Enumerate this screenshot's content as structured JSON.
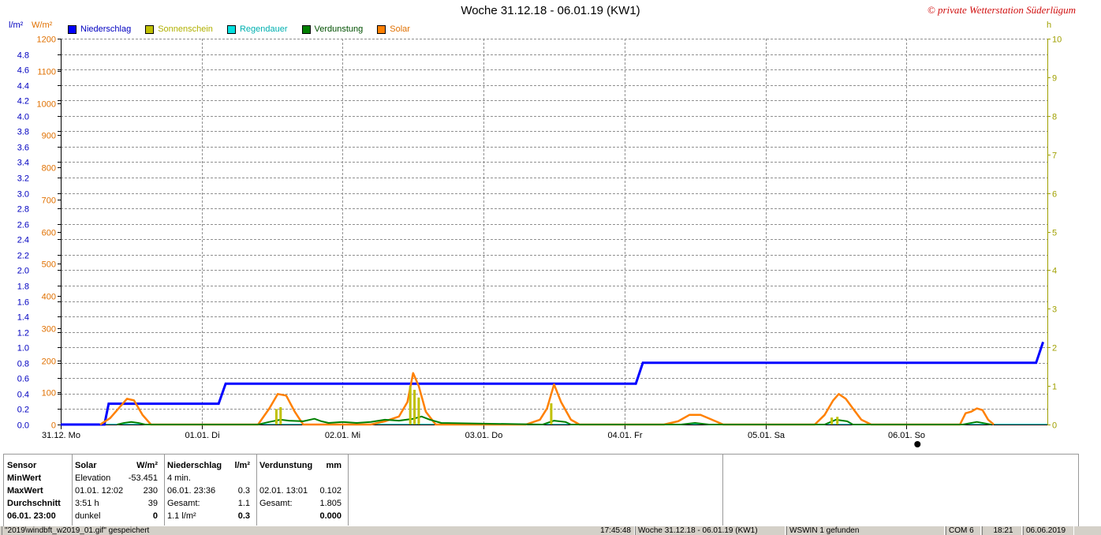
{
  "title": "Woche 31.12.18 - 06.01.19 (KW1)",
  "copyright": "© private Wetterstation Süderlügum",
  "units": {
    "left1": "l/m²",
    "left2": "W/m²",
    "right": "h"
  },
  "legend": [
    {
      "label": "Niederschlag",
      "color": "#0000ff",
      "text_color": "#0000c0"
    },
    {
      "label": "Sonnenschein",
      "color": "#c0c000",
      "text_color": "#b0b000"
    },
    {
      "label": "Regendauer",
      "color": "#00e0e0",
      "text_color": "#00b0b0"
    },
    {
      "label": "Verdunstung",
      "color": "#008000",
      "text_color": "#005000"
    },
    {
      "label": "Solar",
      "color": "#ff8000",
      "text_color": "#e07000"
    }
  ],
  "chart_data": {
    "type": "line",
    "title": "Woche 31.12.18 - 06.01.19 (KW1)",
    "x_range_days": [
      0,
      7
    ],
    "x_ticks": [
      "31.12.  Mo",
      "01.01.  Di",
      "02.01.  Mi",
      "03.01.  Do",
      "04.01.  Fr",
      "05.01.  Sa",
      "06.01.  So"
    ],
    "y_left_precip": {
      "label": "l/m²",
      "range": [
        0,
        5.0
      ],
      "ticks": [
        "0.0",
        "0.2",
        "0.4",
        "0.6",
        "0.8",
        "1.0",
        "1.2",
        "1.4",
        "1.6",
        "1.8",
        "2.0",
        "2.2",
        "2.4",
        "2.6",
        "2.8",
        "3.0",
        "3.2",
        "3.4",
        "3.6",
        "3.8",
        "4.0",
        "4.2",
        "4.4",
        "4.6",
        "4.8"
      ]
    },
    "y_left_solar": {
      "label": "W/m²",
      "range": [
        0,
        1200
      ],
      "ticks": [
        "0",
        "100",
        "200",
        "300",
        "400",
        "500",
        "600",
        "700",
        "800",
        "900",
        "1000",
        "1100",
        "1200"
      ]
    },
    "y_right_hours": {
      "label": "h",
      "range": [
        0,
        10
      ],
      "ticks": [
        "0",
        "1",
        "2",
        "3",
        "4",
        "5",
        "6",
        "7",
        "8",
        "9",
        "10"
      ]
    },
    "series": [
      {
        "name": "Niederschlag",
        "axis": "precip",
        "color": "#0000ff",
        "x": [
          0,
          0.31,
          0.34,
          1.12,
          1.17,
          4.08,
          4.13,
          6.92,
          6.97
        ],
        "y": [
          0,
          0,
          0.27,
          0.27,
          0.53,
          0.53,
          0.8,
          0.8,
          1.07
        ]
      },
      {
        "name": "Solar",
        "axis": "solar",
        "color": "#ff8000",
        "x": [
          0.28,
          0.35,
          0.42,
          0.47,
          0.52,
          0.58,
          0.64,
          1.4,
          1.48,
          1.54,
          1.6,
          1.66,
          1.72,
          2.2,
          2.3,
          2.4,
          2.46,
          2.5,
          2.54,
          2.59,
          2.66,
          3.3,
          3.4,
          3.45,
          3.5,
          3.55,
          3.62,
          3.68,
          4.28,
          4.38,
          4.46,
          4.54,
          4.62,
          4.7,
          5.35,
          5.42,
          5.48,
          5.52,
          5.57,
          5.62,
          5.68,
          5.75,
          6.38,
          6.42,
          6.46,
          6.5,
          6.54,
          6.58,
          6.62
        ],
        "y": [
          0,
          20,
          55,
          80,
          75,
          30,
          0,
          0,
          50,
          95,
          90,
          40,
          0,
          0,
          10,
          25,
          70,
          160,
          120,
          40,
          0,
          0,
          15,
          50,
          125,
          70,
          15,
          0,
          0,
          10,
          30,
          30,
          15,
          0,
          0,
          30,
          75,
          95,
          80,
          50,
          15,
          0,
          0,
          35,
          40,
          50,
          45,
          15,
          0
        ]
      },
      {
        "name": "Verdunstung",
        "axis": "solar",
        "color": "#008000",
        "x": [
          0.4,
          0.45,
          0.5,
          0.55,
          0.6,
          1.4,
          1.48,
          1.56,
          1.62,
          1.72,
          1.8,
          1.85,
          1.9,
          2.0,
          2.1,
          2.2,
          2.3,
          2.4,
          2.5,
          2.56,
          2.62,
          2.7,
          3.42,
          3.5,
          3.58,
          3.62,
          4.4,
          4.5,
          4.6,
          5.42,
          5.5,
          5.58,
          5.62,
          6.4,
          6.5,
          6.6
        ],
        "y": [
          0,
          5,
          8,
          5,
          0,
          0,
          8,
          15,
          12,
          10,
          18,
          10,
          5,
          8,
          5,
          8,
          15,
          12,
          18,
          25,
          15,
          5,
          0,
          12,
          8,
          0,
          0,
          5,
          0,
          0,
          15,
          10,
          0,
          0,
          8,
          0
        ]
      },
      {
        "name": "Sonnenschein",
        "axis": "hours",
        "type": "bar",
        "color": "#c0c000",
        "x": [
          1.53,
          1.56,
          2.48,
          2.51,
          2.54,
          3.48,
          5.47,
          5.51
        ],
        "y": [
          0.4,
          0.45,
          1.0,
          0.9,
          0.7,
          0.55,
          0.18,
          0.2
        ]
      }
    ]
  },
  "stats": {
    "c1": [
      "Sensor",
      "MinWert",
      "MaxWert",
      "Durchschnitt",
      "06.01. 23:00"
    ],
    "c2": {
      "header": "Solar",
      "unit": "W/m²",
      "rows": [
        [
          "Elevation",
          "-53.451"
        ],
        [
          "01.01.  12:02",
          "230"
        ],
        [
          "3:51 h",
          "39"
        ],
        [
          "dunkel",
          "0"
        ]
      ]
    },
    "c3": {
      "header": "Niederschlag",
      "unit": "l/m²",
      "rows": [
        [
          "4 min.",
          ""
        ],
        [
          "06.01.  23:36",
          "0.3"
        ],
        [
          "Gesamt:",
          "1.1"
        ],
        [
          " 1.1 l/m²",
          "0.3"
        ]
      ]
    },
    "c4": {
      "header": "Verdunstung",
      "unit": "mm",
      "rows": [
        [
          "",
          ""
        ],
        [
          "02.01.  13:01",
          "0.102"
        ],
        [
          "Gesamt:",
          "1.805"
        ],
        [
          "",
          "0.000"
        ]
      ]
    }
  },
  "statusbar": {
    "file": "\"2019\\windbft_w2019_01.gif\" gespeichert",
    "time": "17:45:48",
    "week": "Woche 31.12.18 - 06.01.19 (KW1)",
    "found": "WSWIN 1 gefunden",
    "port": "COM 6",
    "clock": "18:21",
    "date": "06.06.2019"
  }
}
